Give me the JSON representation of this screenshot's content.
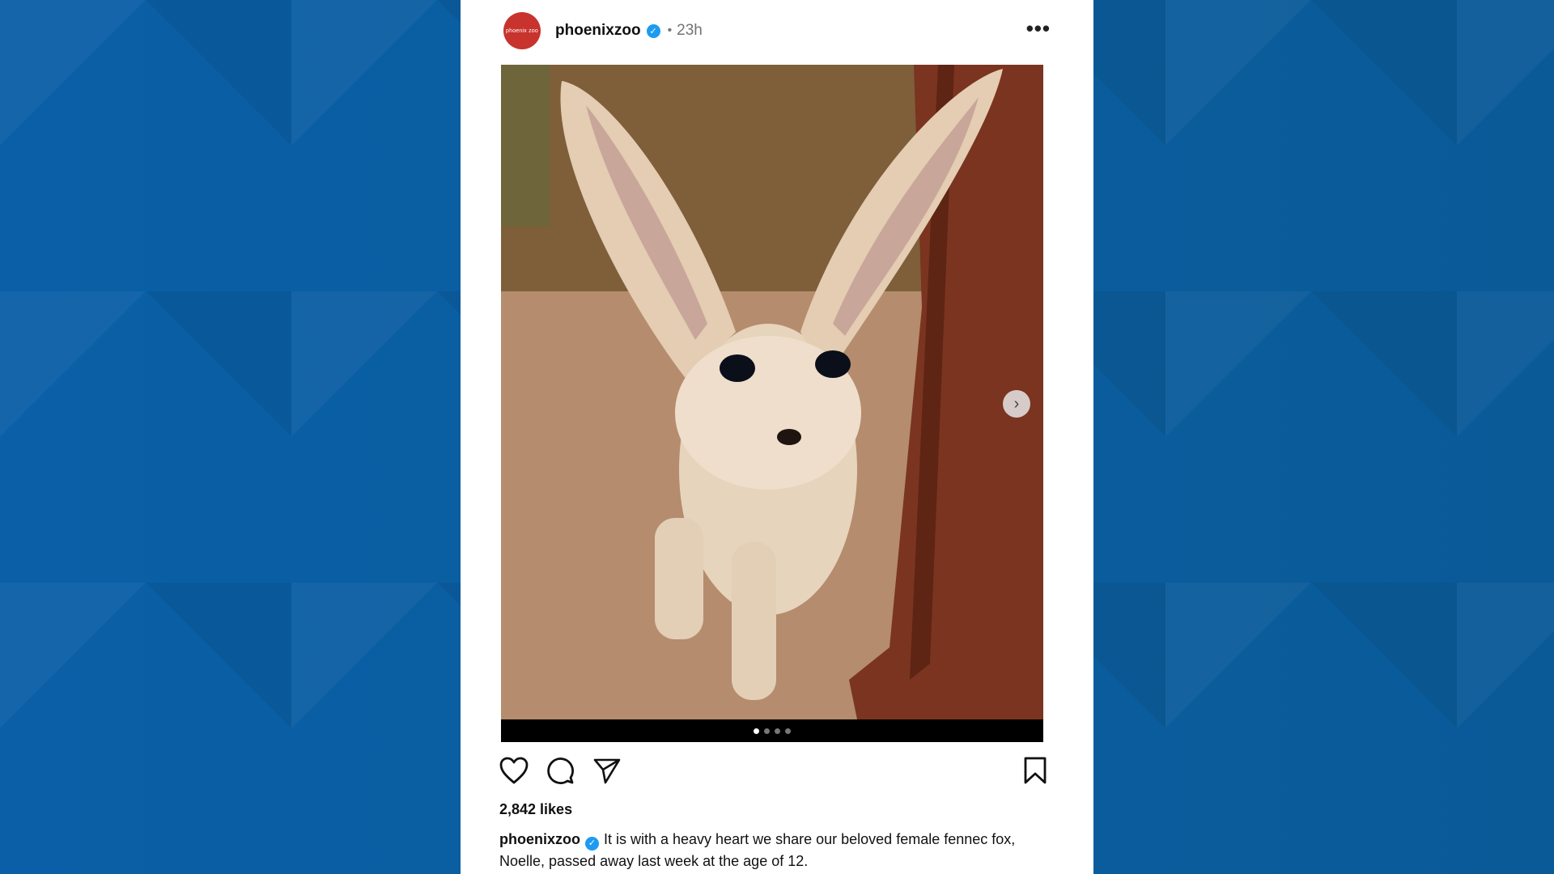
{
  "post": {
    "avatar_text": "phoenix zoo",
    "username": "phoenixzoo",
    "verified_glyph": "✓",
    "separator": "•",
    "time": "23h",
    "more_label": "•••",
    "carousel": {
      "pages": 4,
      "current": 1
    },
    "likes": "2,842 likes",
    "caption_user": "phoenixzoo",
    "caption_text": "It is with a heavy heart we share our beloved female fennec fox, Noelle, passed away last week at the age of 12."
  },
  "icons": {
    "avatar": "zoo-logo-icon",
    "verified": "verified-badge-icon",
    "more": "more-options-icon",
    "next": "chevron-right-icon",
    "like": "heart-icon",
    "comment": "comment-icon",
    "share": "send-icon",
    "save": "bookmark-icon"
  },
  "colors": {
    "background": "#0a5a9c",
    "card": "#ffffff",
    "verified": "#1d9bf0",
    "avatar": "#c8332d"
  }
}
